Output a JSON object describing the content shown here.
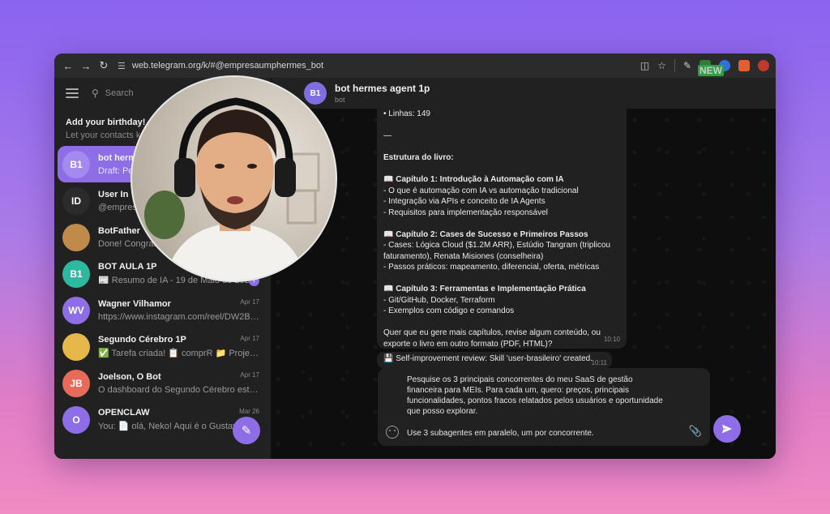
{
  "browser": {
    "url": "web.telegram.org/k/#@empresaumphermes_bot",
    "ext_new_label": "NEW"
  },
  "sidebar": {
    "search_placeholder": "Search",
    "birthday": {
      "title": "Add your birthday! ✋",
      "subtitle": "Let your contacts kn"
    },
    "chats": [
      {
        "initials": "B1",
        "name": "bot herme",
        "preview": "Draft: Pes",
        "date": "",
        "color": "#8e6ee6",
        "active": true
      },
      {
        "initials": "ID",
        "name": "User In",
        "preview": "@empresa",
        "date": "",
        "color": "#2b2b2b",
        "active": false
      },
      {
        "initials": "",
        "name": "BotFather",
        "preview": "Done! Congratu",
        "date": "",
        "color": "#c08b4a",
        "active": false
      },
      {
        "initials": "B1",
        "name": "BOT AULA 1P",
        "preview": "📰 Resumo de IA - 19 de Maio de 2026",
        "date": "",
        "color": "#2fb8a0",
        "active": false
      },
      {
        "initials": "WV",
        "name": "Wagner Vilhamor",
        "preview": "https://www.instagram.com/reel/DW2BGfl...",
        "date": "Apr 17",
        "color": "#8e6ee6",
        "active": false
      },
      {
        "initials": "",
        "name": "Segundo Cérebro 1P",
        "preview": "✅ Tarefa criada! 📋 comprR 📁 Projeto 1",
        "date": "Apr 17",
        "color": "#e6b84a",
        "active": false
      },
      {
        "initials": "JB",
        "name": "Joelson, O Bot",
        "preview": "O dashboard do Segundo Cérebro está em: ...",
        "date": "Apr 17",
        "color": "#e86a5a",
        "active": false
      },
      {
        "initials": "O",
        "name": "OPENCLAW",
        "preview": "You: 📄 olá, Neko! Aqui é o Gustavo! S",
        "date": "Mar 26",
        "color": "#8e6ee6",
        "active": false
      }
    ],
    "badge_count": "7"
  },
  "chat": {
    "header_initials": "B1",
    "header_name": "bot hermes agent 1p",
    "header_sub": "bot",
    "message_lines": [
      {
        "text": "• Linhas: 149",
        "bold": false
      },
      {
        "text": "",
        "bold": false
      },
      {
        "text": "—",
        "bold": false
      },
      {
        "text": "",
        "bold": false
      },
      {
        "text": "Estrutura do livro:",
        "bold": true
      },
      {
        "text": "",
        "bold": false
      },
      {
        "text": "📖 Capítulo 1: Introdução à Automação com IA",
        "bold": true
      },
      {
        "text": "- O que é automação com IA vs automação tradicional",
        "bold": false
      },
      {
        "text": "- Integração via APIs e conceito de IA Agents",
        "bold": false
      },
      {
        "text": "- Requisitos para implementação responsável",
        "bold": false
      },
      {
        "text": "",
        "bold": false
      },
      {
        "text": "📖 Capítulo 2: Cases de Sucesso e Primeiros Passos",
        "bold": true
      },
      {
        "text": "- Cases: Lógica Cloud ($1.2M ARR), Estúdio Tangram (triplicou",
        "bold": false
      },
      {
        "text": "faturamento), Renata Misiones (conselheira)",
        "bold": false
      },
      {
        "text": "- Passos práticos: mapeamento, diferencial, oferta, métricas",
        "bold": false
      },
      {
        "text": "",
        "bold": false
      },
      {
        "text": "📖 Capítulo 3: Ferramentas e Implementação Prática",
        "bold": true
      },
      {
        "text": "- Git/GitHub, Docker, Terraform",
        "bold": false
      },
      {
        "text": "- Exemplos com código e comandos",
        "bold": false
      },
      {
        "text": "",
        "bold": false
      },
      {
        "text": "Quer que eu gere mais capítulos, revise algum conteúdo, ou",
        "bold": false
      },
      {
        "text": "exporte o livro em outro formato (PDF, HTML)?",
        "bold": false
      }
    ],
    "message_time": "10:10",
    "message2_text": "💾 Self-improvement review: Skill 'user-brasileiro' created.",
    "message2_time": "10:11",
    "composer_text": "Pesquise os 3 principais concorrentes do meu SaaS de gestão financeira para MEIs. Para cada um, quero: preços, principais funcionalidades, pontos fracos relatados pelos usuários e oportunidade que posso explorar.",
    "composer_line2": "Use 3 subagentes em paralelo, um por concorrente."
  },
  "colors": {
    "accent": "#8e6ee6",
    "sidebar_bg": "#212121",
    "chat_bg": "#0e0e0e"
  }
}
